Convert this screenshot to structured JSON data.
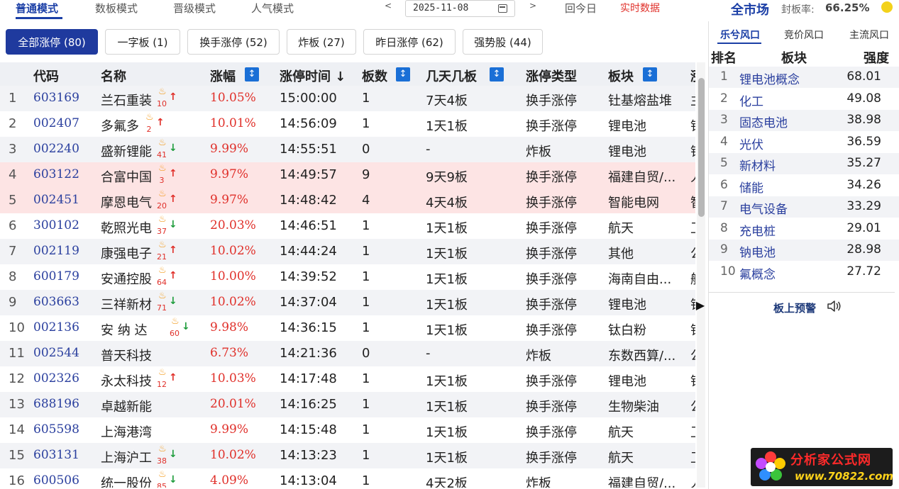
{
  "top": {
    "modes": [
      "普通模式",
      "数板模式",
      "晋级模式",
      "人气模式"
    ],
    "active_mode": 0,
    "prev_label": "<",
    "next_label": ">",
    "date": "2025-11-08",
    "today_label": "回今日",
    "realtime_label": "实时数据",
    "market_title": "全市场",
    "seal_label": "封板率:",
    "seal_rate": "66.25%"
  },
  "filters": [
    "全部涨停 (80)",
    "一字板 (1)",
    "换手涨停 (52)",
    "炸板 (27)",
    "昨日涨停 (62)",
    "强势股 (44)"
  ],
  "table": {
    "headers": [
      "代码",
      "名称",
      "涨幅",
      "涨停时间 ↓",
      "板数",
      "几天几板",
      "涨停类型",
      "板块",
      "涨"
    ],
    "rows": [
      {
        "idx": "1",
        "code": "603169",
        "name": "兰石重装",
        "heat": "10",
        "trend": "up",
        "pct": "10.05%",
        "time": "15:00:00",
        "boards": "1",
        "days": "7天4板",
        "type": "换手涨停",
        "sector": "钍基熔盐堆",
        "extra": "主"
      },
      {
        "idx": "2",
        "code": "002407",
        "name": "多氟多",
        "heat": "2",
        "trend": "up",
        "pct": "10.01%",
        "time": "14:56:09",
        "boards": "1",
        "days": "1天1板",
        "type": "换手涨停",
        "sector": "锂电池",
        "extra": "锂"
      },
      {
        "idx": "3",
        "code": "002240",
        "name": "盛新锂能",
        "heat": "41",
        "trend": "down",
        "pct": "9.99%",
        "time": "14:55:51",
        "boards": "0",
        "days": "-",
        "type": "炸板",
        "sector": "锂电池",
        "extra": "锂"
      },
      {
        "idx": "4",
        "code": "603122",
        "name": "合富中国",
        "heat": "3",
        "trend": "up",
        "pct": "9.97%",
        "time": "14:49:57",
        "boards": "9",
        "days": "9天9板",
        "type": "换手涨停",
        "sector": "福建自贸/...",
        "extra": "人"
      },
      {
        "idx": "5",
        "code": "002451",
        "name": "摩恩电气",
        "heat": "20",
        "trend": "up",
        "pct": "9.97%",
        "time": "14:48:42",
        "boards": "4",
        "days": "4天4板",
        "type": "换手涨停",
        "sector": "智能电网",
        "extra": "智"
      },
      {
        "idx": "6",
        "code": "300102",
        "name": "乾照光电",
        "heat": "37",
        "trend": "down",
        "pct": "20.03%",
        "time": "14:46:51",
        "boards": "1",
        "days": "1天1板",
        "type": "换手涨停",
        "sector": "航天",
        "extra": "卫"
      },
      {
        "idx": "7",
        "code": "002119",
        "name": "康强电子",
        "heat": "21",
        "trend": "up",
        "pct": "10.02%",
        "time": "14:44:24",
        "boards": "1",
        "days": "1天1板",
        "type": "换手涨停",
        "sector": "其他",
        "extra": "公"
      },
      {
        "idx": "8",
        "code": "600179",
        "name": "安通控股",
        "heat": "64",
        "trend": "up",
        "pct": "10.00%",
        "time": "14:39:52",
        "boards": "1",
        "days": "1天1板",
        "type": "换手涨停",
        "sector": "海南自由...",
        "extra": "航"
      },
      {
        "idx": "9",
        "code": "603663",
        "name": "三祥新材",
        "heat": "71",
        "trend": "down",
        "pct": "10.02%",
        "time": "14:37:04",
        "boards": "1",
        "days": "1天1板",
        "type": "换手涨停",
        "sector": "锂电池",
        "extra": "锂"
      },
      {
        "idx": "10",
        "code": "002136",
        "name": "安 纳 达",
        "heat": "60",
        "trend": "down",
        "pct": "9.98%",
        "time": "14:36:15",
        "boards": "1",
        "days": "1天1板",
        "type": "换手涨停",
        "sector": "钛白粉",
        "extra": "锂"
      },
      {
        "idx": "11",
        "code": "002544",
        "name": "普天科技",
        "heat": "",
        "trend": "",
        "pct": "6.73%",
        "time": "14:21:36",
        "boards": "0",
        "days": "-",
        "type": "炸板",
        "sector": "东数西算/...",
        "extra": "公"
      },
      {
        "idx": "12",
        "code": "002326",
        "name": "永太科技",
        "heat": "12",
        "trend": "up",
        "pct": "10.03%",
        "time": "14:17:48",
        "boards": "1",
        "days": "1天1板",
        "type": "换手涨停",
        "sector": "锂电池",
        "extra": "锂"
      },
      {
        "idx": "13",
        "code": "688196",
        "name": "卓越新能",
        "heat": "",
        "trend": "",
        "pct": "20.01%",
        "time": "14:16:25",
        "boards": "1",
        "days": "1天1板",
        "type": "换手涨停",
        "sector": "生物柴油",
        "extra": "公"
      },
      {
        "idx": "14",
        "code": "605598",
        "name": "上海港湾",
        "heat": "",
        "trend": "",
        "pct": "9.99%",
        "time": "14:15:48",
        "boards": "1",
        "days": "1天1板",
        "type": "换手涨停",
        "sector": "航天",
        "extra": "卫"
      },
      {
        "idx": "15",
        "code": "603131",
        "name": "上海沪工",
        "heat": "38",
        "trend": "down",
        "pct": "10.02%",
        "time": "14:13:23",
        "boards": "1",
        "days": "1天1板",
        "type": "换手涨停",
        "sector": "航天",
        "extra": "卫"
      },
      {
        "idx": "16",
        "code": "600506",
        "name": "统一股份",
        "heat": "85",
        "trend": "down",
        "pct": "4.09%",
        "time": "14:13:04",
        "boards": "1",
        "days": "4天2板",
        "type": "炸板",
        "sector": "福建自贸/...",
        "extra": "人"
      }
    ]
  },
  "panel": {
    "tabs": [
      "乐兮风口",
      "竞价风口",
      "主流风口"
    ],
    "active_tab": 0,
    "headers": [
      "排名",
      "板块",
      "强度"
    ],
    "rows": [
      {
        "rank": "1",
        "name": "锂电池概念",
        "value": "68.01"
      },
      {
        "rank": "2",
        "name": "化工",
        "value": "49.08"
      },
      {
        "rank": "3",
        "name": "固态电池",
        "value": "38.98"
      },
      {
        "rank": "4",
        "name": "光伏",
        "value": "36.59"
      },
      {
        "rank": "5",
        "name": "新材料",
        "value": "35.27"
      },
      {
        "rank": "6",
        "name": "储能",
        "value": "34.26"
      },
      {
        "rank": "7",
        "name": "电气设备",
        "value": "33.29"
      },
      {
        "rank": "8",
        "name": "充电桩",
        "value": "29.01"
      },
      {
        "rank": "9",
        "name": "钠电池",
        "value": "28.98"
      },
      {
        "rank": "10",
        "name": "氟概念",
        "value": "27.72"
      }
    ],
    "alert_label": "板上预警"
  },
  "logo": {
    "title": "分析家公式网",
    "url": "www.70822.com"
  },
  "colors": {
    "accent": "#1b3fa6",
    "up": "#e0302a",
    "down": "#1e9c3c",
    "highlight_row": "#fde4e4"
  }
}
